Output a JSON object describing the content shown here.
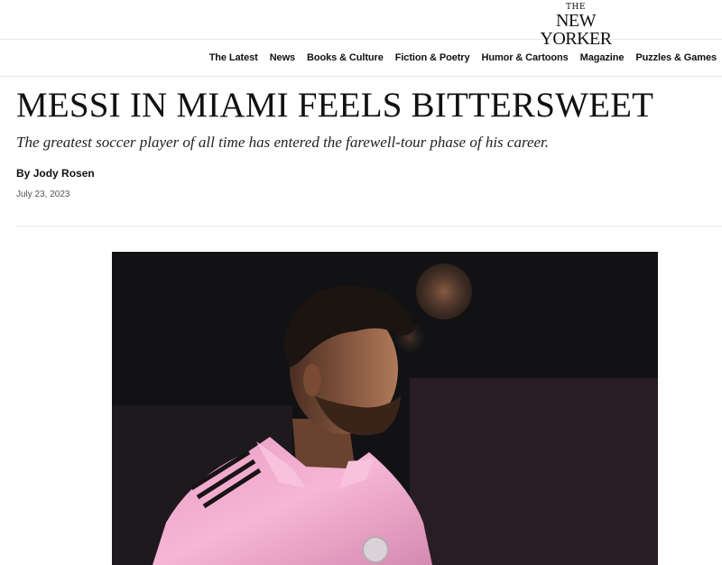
{
  "header": {
    "logo_the": "THE",
    "logo_main": "NEW YORKER"
  },
  "nav": {
    "items": [
      {
        "label": "The Latest"
      },
      {
        "label": "News"
      },
      {
        "label": "Books & Culture"
      },
      {
        "label": "Fiction & Poetry"
      },
      {
        "label": "Humor & Cartoons"
      },
      {
        "label": "Magazine"
      },
      {
        "label": "Puzzles & Games"
      }
    ]
  },
  "article": {
    "headline": "MESSI IN MIAMI FEELS BITTERSWEET",
    "dek": "The greatest soccer player of all time has entered the farewell-tour phase of his career.",
    "byline_prefix": "By ",
    "author": "Jody Rosen",
    "date": "July 23, 2023"
  },
  "colors": {
    "jersey_pink": "#f2a9cd",
    "background_dark": "#141416"
  }
}
